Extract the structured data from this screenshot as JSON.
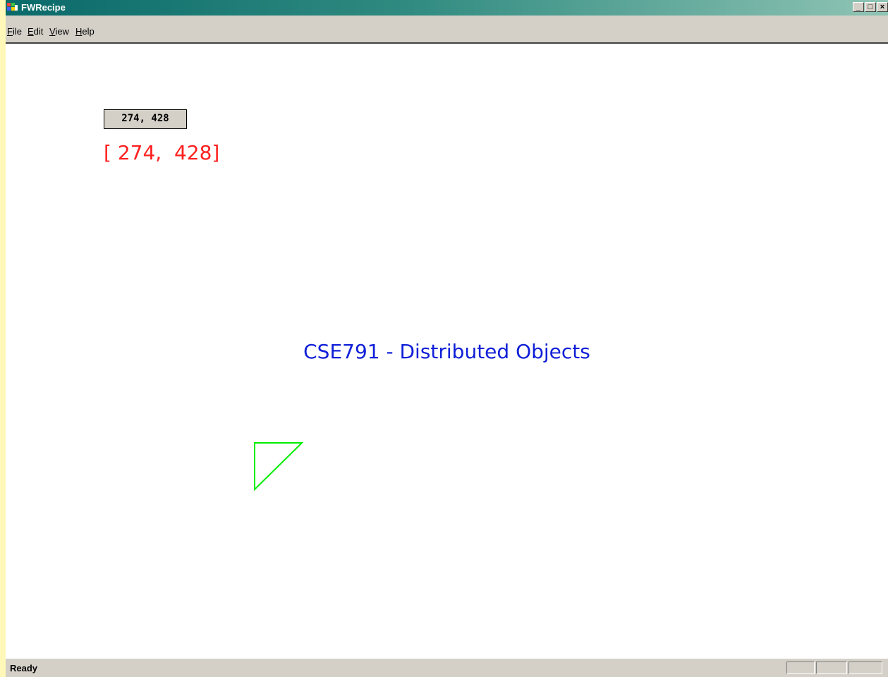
{
  "window": {
    "title": "FWRecipe",
    "controls": {
      "minimize": "_",
      "maximize": "□",
      "close": "×"
    }
  },
  "menu": {
    "items": [
      {
        "label": "File",
        "mnemonic": "F",
        "rest": "ile"
      },
      {
        "label": "Edit",
        "mnemonic": "E",
        "rest": "dit"
      },
      {
        "label": "View",
        "mnemonic": "V",
        "rest": "iew"
      },
      {
        "label": "Help",
        "mnemonic": "H",
        "rest": "elp"
      }
    ]
  },
  "canvas": {
    "coord_box_text": "274, 428",
    "coord_text": "[ 274,  428]",
    "course_title": "CSE791 - Distributed Objects",
    "colors": {
      "coord_text": "#ff2020",
      "course_title": "#1020d8",
      "triangle": "#00ee00"
    }
  },
  "status": {
    "text": "Ready"
  }
}
